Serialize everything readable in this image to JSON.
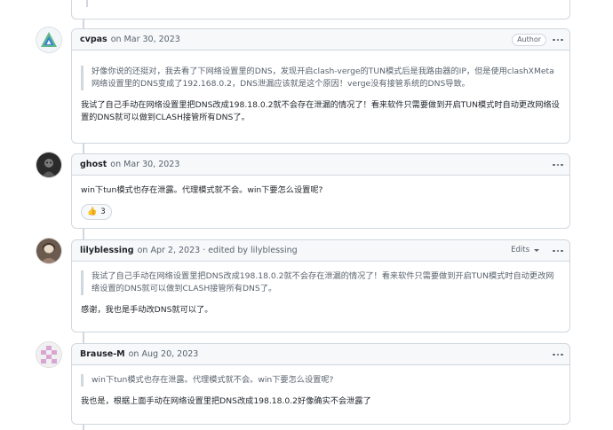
{
  "comments": [
    {
      "author": "cvpas",
      "date": "on Mar 30, 2023",
      "badge": "Author",
      "quote": "好像你说的还挺对，我去看了下网络设置里的DNS，发现开启clash-verge的TUN模式后是我路由器的IP，但是使用clashXMeta网络设置里的DNS变成了192.168.0.2，DNS泄漏应该就是这个原因！verge没有接管系统的DNS导致。",
      "text": "我试了自己手动在网络设置里把DNS改成198.18.0.2就不会存在泄漏的情况了！看来软件只需要做到开启TUN模式时自动更改网络设置的DNS就可以做到CLASH接管所有DNS了。",
      "avatar_icon": "triangle-logo-icon",
      "colors": {
        "avatar_green": "#5fb88a",
        "avatar_blue": "#3a7ed6"
      }
    },
    {
      "author": "ghost",
      "date": "on Mar 30, 2023",
      "text": "win下tun模式也存在泄露。代理模式就不会。win下要怎么设置呢?",
      "reaction": {
        "emoji": "👍",
        "count": "3"
      },
      "avatar_icon": "ghost-avatar-icon"
    },
    {
      "author": "lilyblessing",
      "date": "on Apr 2, 2023",
      "edited": "· edited by lilyblessing",
      "edits_label": "Edits",
      "quote": "我试了自己手动在网络设置里把DNS改成198.18.0.2就不会存在泄漏的情况了！看来软件只需要做到开启TUN模式时自动更改网络设置的DNS就可以做到CLASH接管所有DNS了。",
      "text": "感谢，我也是手动改DNS就可以了。",
      "avatar_icon": "user-photo-icon"
    },
    {
      "author": "Brause-M",
      "date": "on Aug 20, 2023",
      "quote": "win下tun模式也存在泄露。代理模式就不会。win下要怎么设置呢?",
      "text": "我也是，根据上面手动在网络设置里把DNS改成198.18.0.2好像确实不会泄露了",
      "avatar_icon": "identicon-icon",
      "colors": {
        "identicon": "#d9a6d4"
      }
    }
  ]
}
